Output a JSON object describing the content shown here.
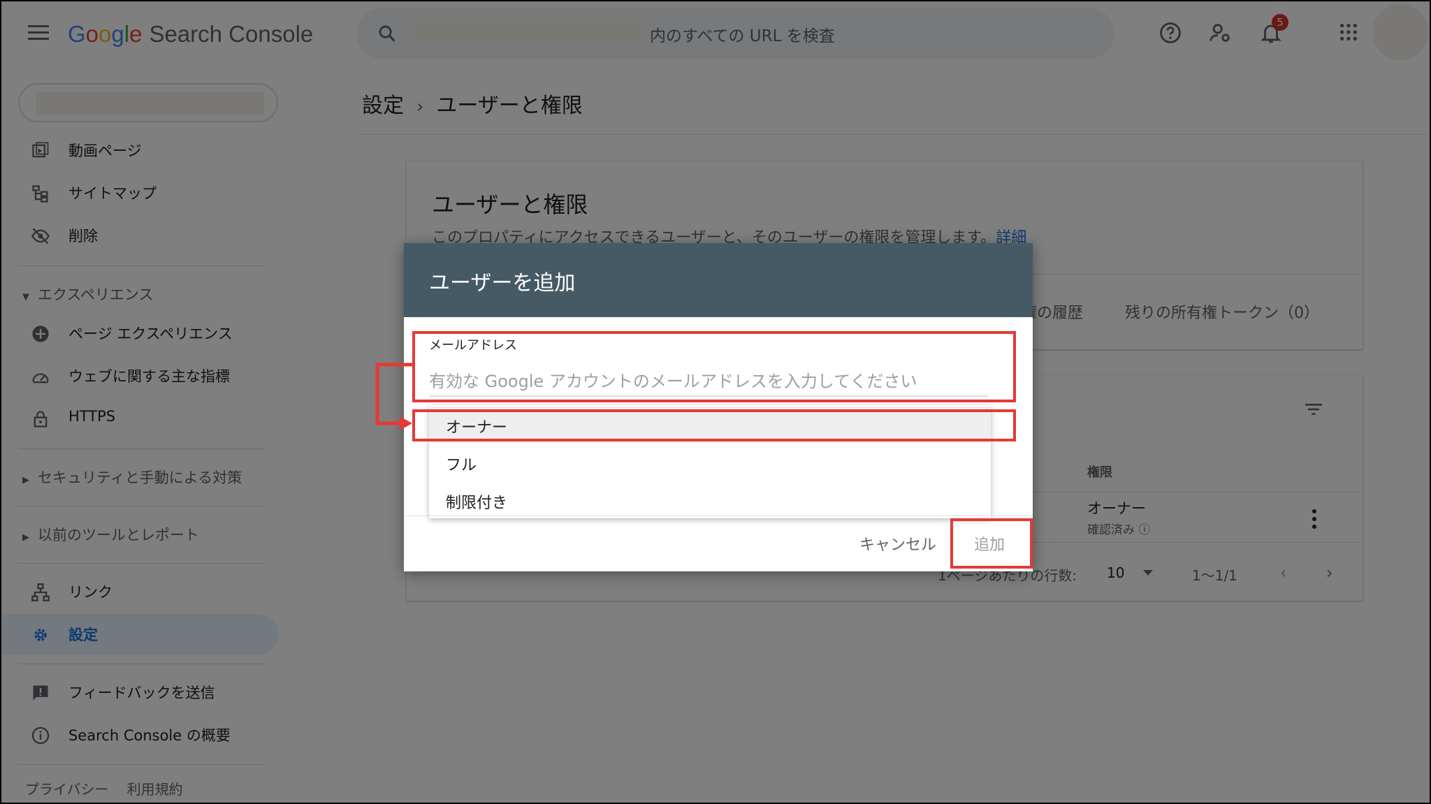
{
  "topbar": {
    "logo_google": "Google",
    "logo_product": "Search Console",
    "search_placeholder": "内のすべての URL を検査",
    "notification_count": "5"
  },
  "sidebar": {
    "items_top": [
      {
        "label": "動画ページ",
        "icon": "video-page-icon"
      },
      {
        "label": "サイトマップ",
        "icon": "sitemap-icon"
      },
      {
        "label": "削除",
        "icon": "removal-icon"
      }
    ],
    "section_experience": "エクスペリエンス",
    "items_experience": [
      {
        "label": "ページ エクスペリエンス",
        "icon": "page-experience-icon"
      },
      {
        "label": "ウェブに関する主な指標",
        "icon": "speed-gauge-icon"
      },
      {
        "label": "HTTPS",
        "icon": "lock-icon"
      }
    ],
    "section_security": "セキュリティと手動による対策",
    "section_legacy": "以前のツールとレポート",
    "item_links": "リンク",
    "item_settings": "設定",
    "item_feedback": "フィードバックを送信",
    "item_about": "Search Console の概要",
    "footer_privacy": "プライバシー",
    "footer_terms": "利用規約"
  },
  "main": {
    "breadcrumb_parent": "設定",
    "breadcrumb_current": "ユーザーと権限",
    "card_title": "ユーザーと権限",
    "card_desc": "このプロパティにアクセスできるユーザーと、そのユーザーの権限を管理します。",
    "card_link": "詳細",
    "tab_history": "権の履歴",
    "tab_tokens": "残りの所有権トークン（0）",
    "col_permission": "権限",
    "row_role": "オーナー",
    "row_status": "確認済み",
    "rows_per_page_label": "1ページあたりの行数:",
    "rows_per_page_value": "10",
    "range": "1〜1/1"
  },
  "dialog": {
    "title": "ユーザーを追加",
    "email_label": "メールアドレス",
    "email_placeholder": "有効な Google アカウントのメールアドレスを入力してください",
    "options": [
      "オーナー",
      "フル",
      "制限付き"
    ],
    "selected_option": "オーナー",
    "cancel_label": "キャンセル",
    "add_label": "追加"
  },
  "colors": {
    "dialog_header": "#455a64",
    "annotation": "#e53935",
    "link": "#1a73e8"
  }
}
